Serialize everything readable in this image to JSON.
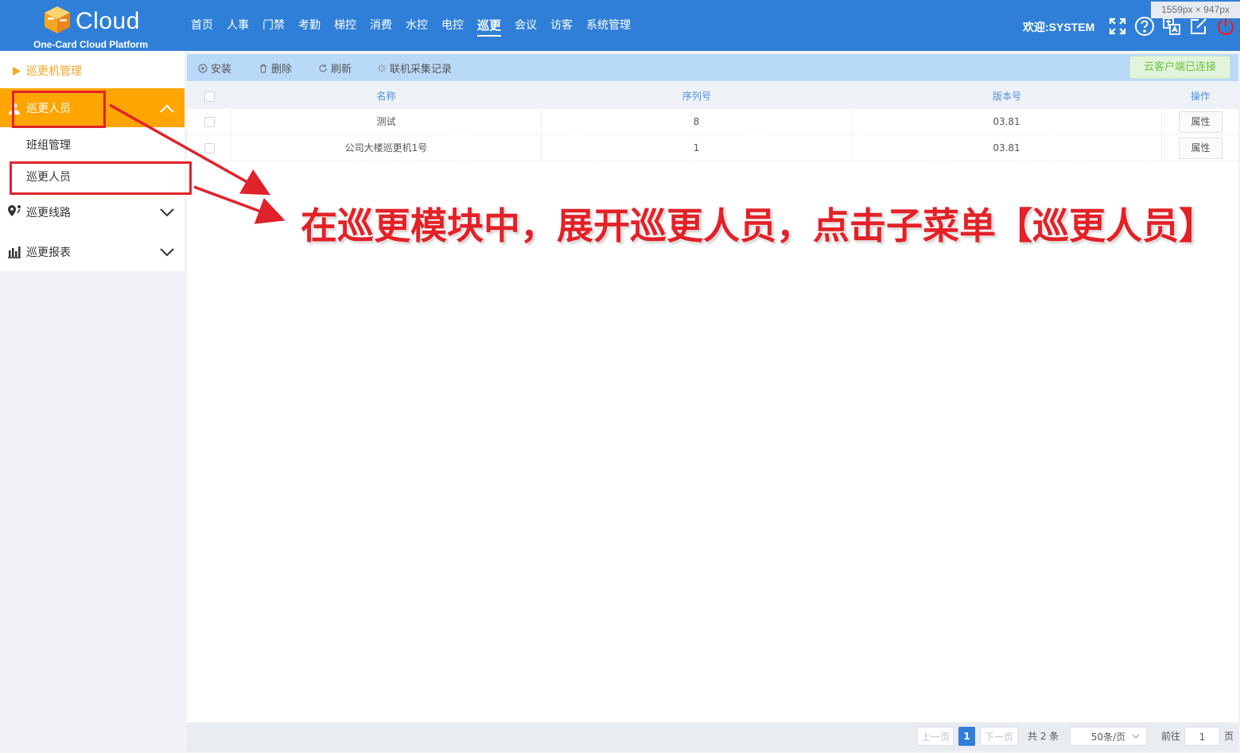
{
  "dim_badge": "1559px × 947px",
  "brand": {
    "name": "Cloud",
    "subtitle": "One-Card Cloud Platform"
  },
  "nav": {
    "items": [
      "首页",
      "人事",
      "门禁",
      "考勤",
      "梯控",
      "消费",
      "水控",
      "电控",
      "巡更",
      "会议",
      "访客",
      "系统管理"
    ],
    "active": "巡更"
  },
  "header": {
    "welcome": "欢迎:SYSTEM",
    "icons": [
      "fullscreen-icon",
      "help-icon",
      "translate-icon",
      "edit-icon",
      "power-icon"
    ]
  },
  "sidebar": {
    "machine_mgmt": "巡更机管理",
    "patrol_staff": "巡更人员",
    "sub_team": "班组管理",
    "sub_staff": "巡更人员",
    "route": "巡更线路",
    "report": "巡更报表"
  },
  "toolbar": {
    "install": "安装",
    "delete": "删除",
    "refresh": "刷新",
    "records": "联机采集记录",
    "connection": "云客户端已连接"
  },
  "table": {
    "headers": {
      "name": "名称",
      "serial": "序列号",
      "version": "版本号",
      "action": "操作"
    },
    "rows": [
      {
        "name": "测试",
        "serial": "8",
        "version": "03.81",
        "action": "属性"
      },
      {
        "name": "公司大楼巡更机1号",
        "serial": "1",
        "version": "03.81",
        "action": "属性"
      }
    ]
  },
  "pager": {
    "prev": "上一页",
    "current": "1",
    "next": "下一页",
    "total": "共 2 条",
    "page_size": "50条/页",
    "goto_label": "前往",
    "goto_value": "1",
    "page_unit": "页"
  },
  "annotation": {
    "text": "在巡更模块中，展开巡更人员，点击子菜单【巡更人员】"
  },
  "colors": {
    "primary": "#2f7fd8",
    "sidebar_active": "#ffa500",
    "annotation": "#e0232a",
    "connected": "#67c23a"
  }
}
